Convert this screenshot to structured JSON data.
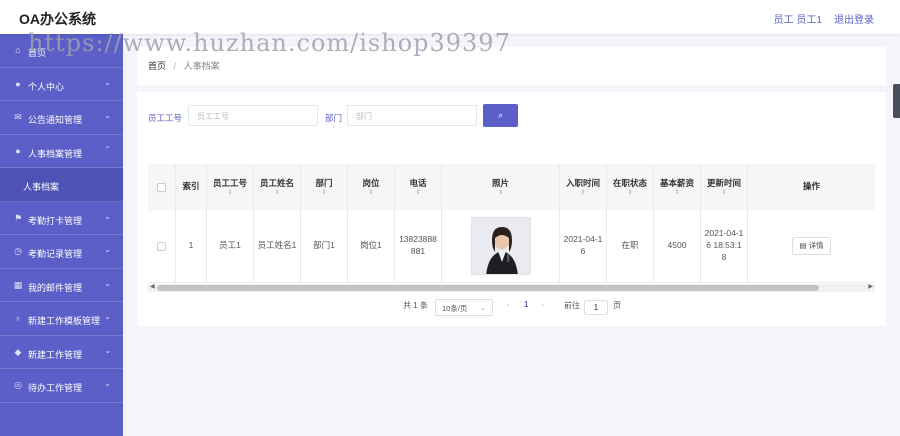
{
  "header": {
    "title": "OA办公系统",
    "user": "员工 员工1",
    "logout": "退出登录"
  },
  "watermark": "https://www.huzhan.com/ishop39397",
  "sidebar": {
    "items": [
      {
        "label": "首页",
        "icon": "home-icon"
      },
      {
        "label": "个人中心",
        "icon": "user-icon",
        "chevron": "⌄"
      },
      {
        "label": "公告通知管理",
        "icon": "mail-icon",
        "chevron": "⌄"
      },
      {
        "label": "人事档案管理",
        "icon": "user-icon",
        "chevron": "⌃"
      },
      {
        "label": "人事档案",
        "sub": true
      },
      {
        "label": "考勤打卡管理",
        "icon": "flag-icon",
        "chevron": "⌄"
      },
      {
        "label": "考勤记录管理",
        "icon": "clock-icon",
        "chevron": "⌄"
      },
      {
        "label": "我的邮件管理",
        "icon": "grid-icon",
        "chevron": "⌄"
      },
      {
        "label": "新建工作模板管理",
        "icon": "mic-icon",
        "chevron": "⌄"
      },
      {
        "label": "新建工作管理",
        "icon": "shield-icon",
        "chevron": "⌄"
      },
      {
        "label": "待办工作管理",
        "icon": "circle-icon",
        "chevron": "⌄"
      }
    ]
  },
  "breadcrumb": {
    "home": "首页",
    "sep": "/",
    "current": "人事档案"
  },
  "search": {
    "emp_no_label": "员工工号",
    "emp_no_placeholder": "员工工号",
    "dept_label": "部门",
    "dept_placeholder": "部门",
    "search_icon": "⌕"
  },
  "table": {
    "headers": [
      "",
      "索引",
      "员工工号",
      "员工姓名",
      "部门",
      "岗位",
      "电话",
      "照片",
      "入职时间",
      "在职状态",
      "基本薪资",
      "更新时间",
      "操作"
    ],
    "rows": [
      {
        "index": "1",
        "emp_no": "员工1",
        "name": "员工姓名1",
        "dept": "部门1",
        "post": "岗位1",
        "phone": "13823888881",
        "hire_date": "2021-04-16",
        "status": "在职",
        "salary": "4500",
        "updated": "2021-04-16 18:53:18",
        "action": "详情"
      }
    ]
  },
  "pagination": {
    "total": "共 1 条",
    "page_size": "10条/页",
    "prev": "‹",
    "current": "1",
    "next": "›",
    "goto": "前往",
    "goto_value": "1",
    "page_unit": "页"
  }
}
